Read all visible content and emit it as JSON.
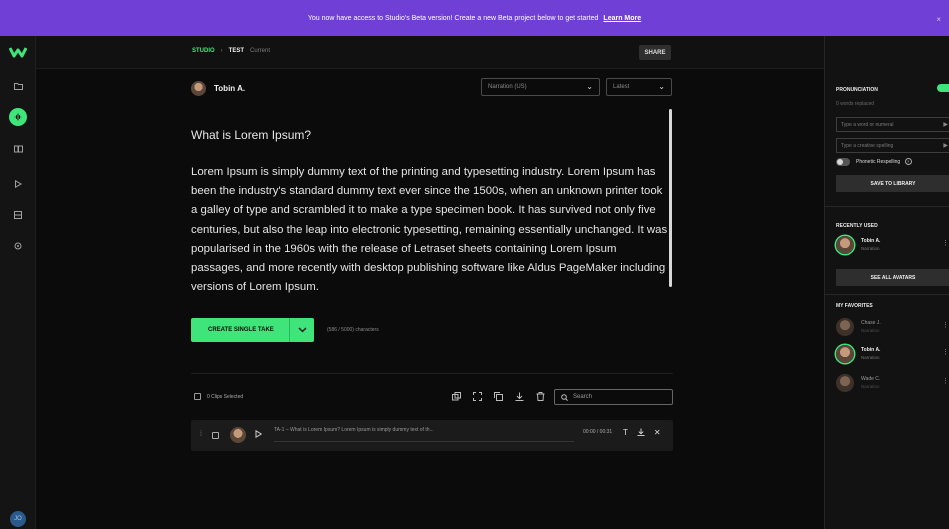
{
  "banner": {
    "message": "You now have access to Studio's Beta version! Create a new Beta project below to get started",
    "link": "Learn More",
    "close": "×"
  },
  "sidebar": {
    "user_initials": "JO"
  },
  "header": {
    "crumb_studio": "STUDIO",
    "crumb_sep": "›",
    "crumb_project": "TEST",
    "crumb_status": "Current",
    "share": "SHARE"
  },
  "speaker": {
    "name": "Tobin A."
  },
  "voice_select": {
    "value": "Narration (US)"
  },
  "version_select": {
    "value": "Latest"
  },
  "document": {
    "title": "What is Lorem Ipsum?",
    "body": "Lorem Ipsum is simply dummy text of the printing and typesetting industry. Lorem Ipsum has been the industry's standard dummy text ever since the 1500s, when an unknown printer took a galley of type and scrambled it to make a type specimen book. It has survived not only five centuries, but also the leap into electronic typesetting, remaining essentially unchanged. It was popularised in the 1960s with the release of Letraset sheets containing Lorem Ipsum passages, and more recently with desktop publishing software like Aldus PageMaker including versions of Lorem Ipsum."
  },
  "create": {
    "label": "CREATE SINGLE TAKE",
    "char_count": "(586 / 5000) characters"
  },
  "clips": {
    "selected_label": "0 Clips Selected",
    "search_placeholder": "Search",
    "rows": [
      {
        "text": "TA-1 – What is Lorem Ipsum? Lorem Ipsum is simply dummy text of th...",
        "time": "00:00 / 00:31"
      }
    ]
  },
  "pronunciation": {
    "heading": "PRONUNCIATION",
    "replaced": "0 words replaced",
    "word_placeholder": "Type a word or numeral",
    "spelling_placeholder": "Type a creative spelling",
    "phonetic_label": "Phonetic Respelling",
    "save_button": "SAVE TO LIBRARY"
  },
  "recently_used": {
    "heading": "RECENTLY USED",
    "items": [
      {
        "name": "Tobin A.",
        "role": "Narration"
      }
    ],
    "see_all": "SEE ALL AVATARS"
  },
  "favorites": {
    "heading": "MY FAVORITES",
    "items": [
      {
        "name": "Chase J.",
        "role": "Narration"
      },
      {
        "name": "Tobin A.",
        "role": "Narration"
      },
      {
        "name": "Wade C.",
        "role": "Narration"
      }
    ]
  },
  "colors": {
    "accent": "#3fe47a",
    "banner": "#6f3fd6",
    "background": "#0b0b0b",
    "panel": "#121212"
  },
  "icons": [
    "logo-icon",
    "folder-icon",
    "voice-icon",
    "book-icon",
    "play-icon",
    "grid-icon",
    "settings-icon",
    "chevron-down-icon",
    "search-icon",
    "copy-icon",
    "expand-icon",
    "duplicate-icon",
    "download-icon",
    "trash-icon",
    "text-icon",
    "close-icon",
    "send-arrow-icon",
    "more-icon",
    "help-icon"
  ]
}
